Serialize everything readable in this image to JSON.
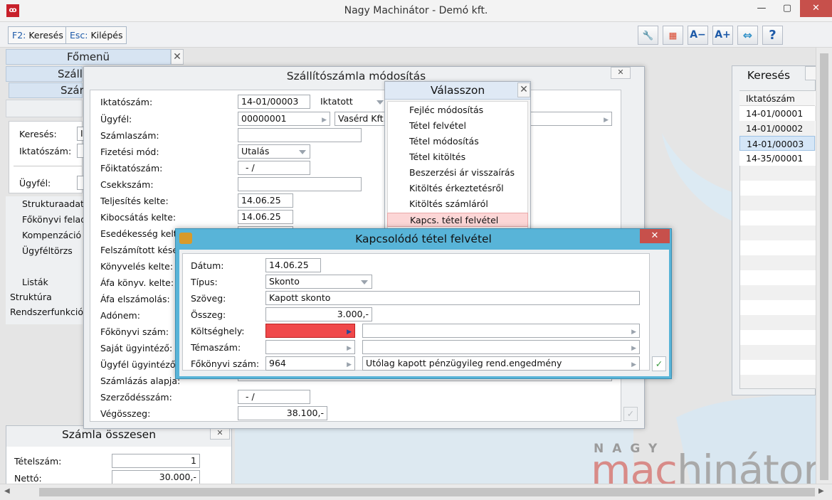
{
  "window": {
    "title": "Nagy Machinátor - Demó kft.",
    "min": "—",
    "max": "▢",
    "close": "✕"
  },
  "toolbar": {
    "search_key": "F2:",
    "search_label": "Keresés",
    "exit_key": "Esc:",
    "exit_label": "Kilépés"
  },
  "tools": [
    {
      "name": "wrench-icon",
      "glyph": "🔧",
      "color": "#2c8a3e"
    },
    {
      "name": "grid-icon",
      "glyph": "▦",
      "color": "#d9442b"
    },
    {
      "name": "font-decrease-icon",
      "glyph": "A−",
      "color": "#1d5aa8"
    },
    {
      "name": "font-increase-icon",
      "glyph": "A+",
      "color": "#1d5aa8"
    },
    {
      "name": "swap-icon",
      "glyph": "⇔",
      "color": "#2a8dc6"
    },
    {
      "name": "help-icon",
      "glyph": "?",
      "color": "#1d5aa8"
    }
  ],
  "fomenu": {
    "title": "Főmenü",
    "close": "✕",
    "tab1": "Száll",
    "tab2": "Szár"
  },
  "left_filter": {
    "kereses": "Keresés:",
    "iktato": "Iktatószám:",
    "ugyfel": "Ügyfél:",
    "kereses_val": "I"
  },
  "left_menu": [
    "Strukturaadat",
    "Főkönyvi felad",
    "Kompenzáció",
    "Ügyféltörzs",
    "Listák",
    "Struktúra",
    "Rendszerfunkció"
  ],
  "szallito": {
    "title": "Szállítószámla módosítás",
    "close": "✕",
    "labels": {
      "iktatoszam": "Iktatószám:",
      "ugyfel": "Ügyfél:",
      "szamlaszam": "Számlaszám:",
      "fizmod": "Fizetési mód:",
      "foiktato": "Főiktatószám:",
      "csekk": "Csekkszám:",
      "teljesites": "Teljesítés kelte:",
      "kibocsatas": "Kibocsátás kelte:",
      "esedekesseg": "Esedékesség kelte",
      "felszamitott": "Felszámított kése",
      "konyveles": "Könyvelés kelte:",
      "afakonyv": "Áfa könyv. kelte:",
      "afaelsz": "Áfa elszámolás:",
      "adonem": "Adónem:",
      "fokonyvi": "Főkönyvi szám:",
      "sajat": "Saját ügyintéző:",
      "ugyfelugy": "Ügyfél ügyintéző",
      "szamlazas": "Számlázás alapja:",
      "szerzodes": "Szerződésszám:",
      "vegosszeg": "Végösszeg:"
    },
    "values": {
      "iktatoszam": "14-01/00003",
      "status": "Iktatott",
      "ugyfel_code": "00000001",
      "ugyfel_name": "Vasérd Kft.",
      "fizmod": "Utalás",
      "foiktato": "-  /",
      "teljesites": "14.06.25",
      "kibocsatas": "14.06.25",
      "szerzodes": "-  /",
      "vegosszeg": "38.100,-"
    }
  },
  "valasszon": {
    "title": "Válasszon",
    "close": "✕",
    "items": [
      "Fejléc módosítás",
      "Tétel felvétel",
      "Tétel módosítás",
      "Tétel kitöltés",
      "Beszerzési ár visszaírás",
      "Kitöltés érkeztetésről",
      "Kitöltés számláról",
      "Kapcs. tétel felvétel"
    ],
    "selected_index": 7
  },
  "kapcsolodo": {
    "title": "Kapcsolódó tétel felvétel",
    "close": "✕",
    "labels": {
      "datum": "Dátum:",
      "tipus": "Típus:",
      "szoveg": "Szöveg:",
      "osszeg": "Összeg:",
      "koltseghely": "Költséghely:",
      "temaszam": "Témaszám:",
      "fokonyvi": "Főkönyvi szám:"
    },
    "values": {
      "datum": "14.06.25",
      "tipus": "Skonto",
      "szoveg": "Kapott skonto",
      "osszeg": "3.000,-",
      "fokonyvi": "964",
      "fokonyvi_name": "Utólag kapott pénzügyileg rend.engedmény"
    },
    "error_color": "#f0484a"
  },
  "kereses": {
    "title": "Keresés",
    "header": "Iktatószám",
    "rows": [
      "14-01/00001",
      "14-01/00002",
      "14-01/00003",
      "14-35/00001"
    ],
    "selected_index": 2
  },
  "osszesen": {
    "title": "Számla összesen",
    "close": "✕",
    "tetelszam_label": "Tételszám:",
    "tetelszam": "1",
    "netto_label": "Nettó:",
    "netto": "30.000,-"
  },
  "logo": {
    "small": "NAGY",
    "main_a": "mac",
    "main_b": "hinátor"
  }
}
